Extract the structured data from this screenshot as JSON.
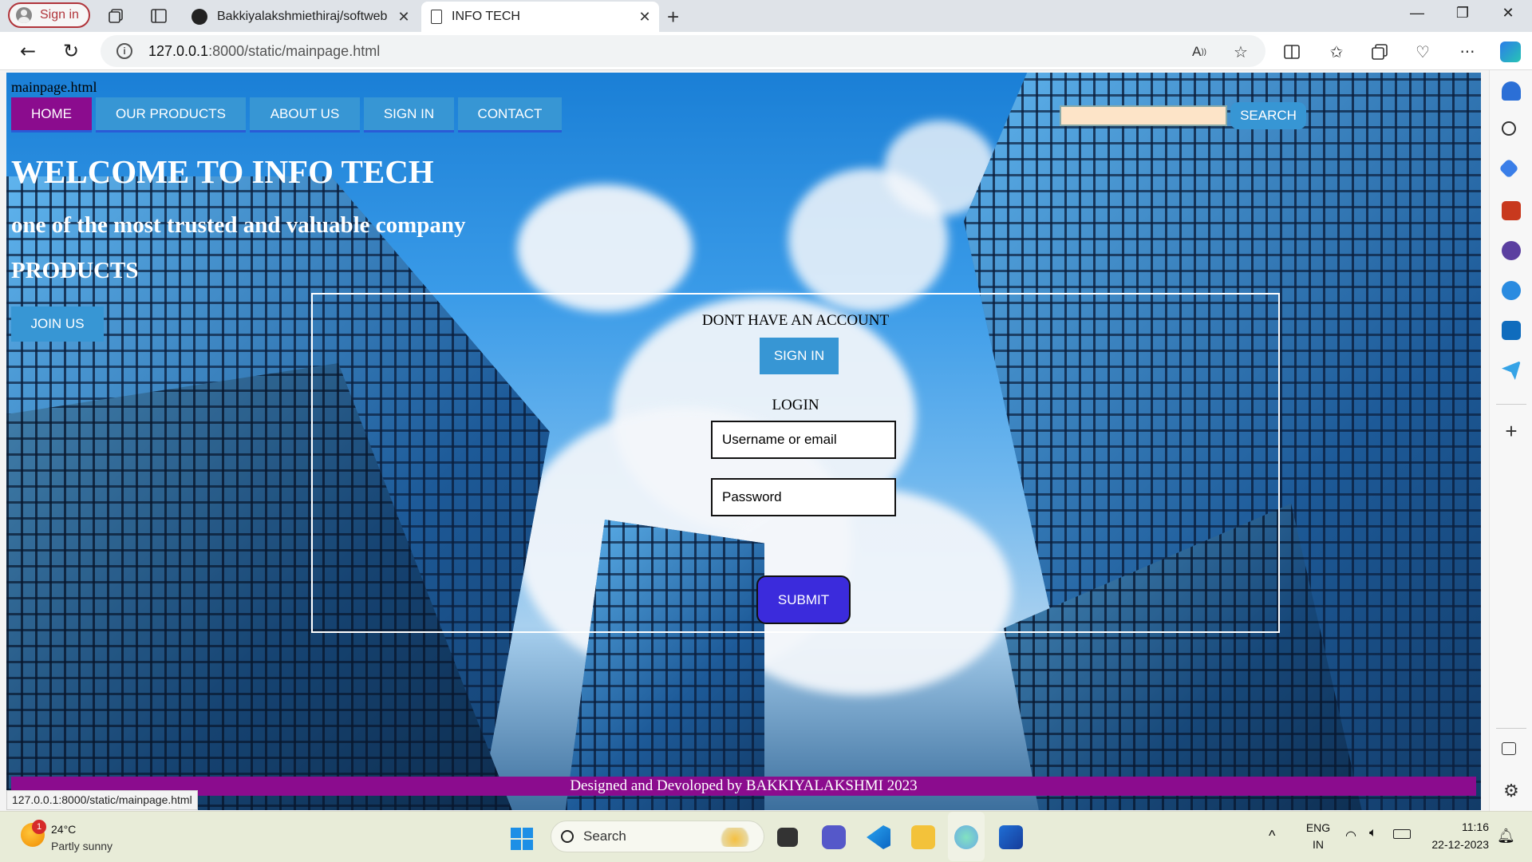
{
  "browser": {
    "profile_label": "Sign in",
    "tabs": [
      {
        "title": "Bakkiyalakshmiethiraj/softweb",
        "active": false
      },
      {
        "title": "INFO TECH",
        "active": true
      }
    ],
    "url_prefix": "127.0.0.1",
    "url_rest": ":8000/static/mainpage.html",
    "status_url": "127.0.0.1:8000/static/mainpage.html"
  },
  "page": {
    "file_label": "mainpage.html",
    "nav": [
      {
        "label": "HOME",
        "active": true
      },
      {
        "label": "OUR PRODUCTS",
        "active": false
      },
      {
        "label": "ABOUT US",
        "active": false
      },
      {
        "label": "SIGN IN",
        "active": false
      },
      {
        "label": "CONTACT",
        "active": false
      }
    ],
    "search_button": "SEARCH",
    "welcome": "WELCOME TO INFO TECH",
    "tagline": "one of the most trusted and valuable company",
    "products_heading": "PRODUCTS",
    "join_button": "JOIN US",
    "login_box": {
      "no_account_text": "DONT HAVE AN ACCOUNT",
      "signin_button": "SIGN IN",
      "login_heading": "LOGIN",
      "username_placeholder": "Username or email",
      "password_placeholder": "Password",
      "submit_button": "SUBMIT"
    },
    "footer": "Designed and Devoloped by BAKKIYALAKSHMI 2023"
  },
  "taskbar": {
    "weather_temp": "24°C",
    "weather_desc": "Partly sunny",
    "weather_badge": "1",
    "search_label": "Search",
    "lang_top": "ENG",
    "lang_bottom": "IN",
    "time": "11:16",
    "date": "22-12-2023"
  },
  "colors": {
    "nav_blue": "#3796d4",
    "nav_active": "#8b0c8e",
    "footer": "#8b0c8e",
    "submit": "#3b2bdc"
  }
}
